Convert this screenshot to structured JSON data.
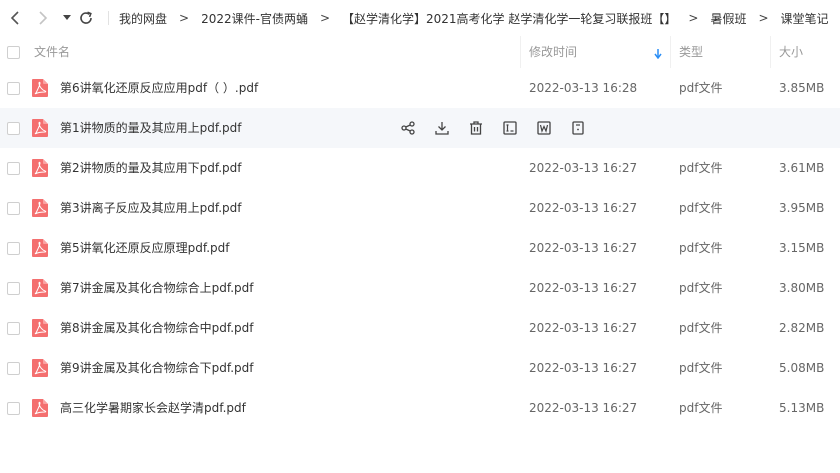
{
  "nav": {
    "back_icon": "chevron-left-icon",
    "forward_icon": "chevron-right-icon",
    "dropdown_icon": "caret-down-icon",
    "refresh_icon": "refresh-icon"
  },
  "breadcrumb": [
    "我的网盘",
    "2022课件-官债两蛹",
    "【赵学清化学】2021高考化学 赵学清化学一轮复习联报班【】",
    "暑假班",
    "课堂笔记"
  ],
  "breadcrumb_separator": ">",
  "columns": {
    "name": "文件名",
    "modified": "修改时间",
    "type": "类型",
    "size": "大小"
  },
  "sort": {
    "column": "modified",
    "direction": "desc",
    "icon": "arrow-down-icon"
  },
  "row_actions": [
    "share-icon",
    "download-icon",
    "delete-icon",
    "rename-icon",
    "word-icon",
    "more-icon"
  ],
  "colors": {
    "pdf": "#f46f6f",
    "sort_arrow": "#2b8ef5",
    "hover_bg": "#f5f7fa"
  },
  "files": [
    {
      "name": "第6讲氧化还原反应应用pdf（ ）.pdf",
      "modified": "2022-03-13 16:28",
      "type": "pdf文件",
      "size": "3.85MB"
    },
    {
      "name": "第1讲物质的量及其应用上pdf.pdf",
      "modified": "",
      "type": "",
      "size": "",
      "hovered": true
    },
    {
      "name": "第2讲物质的量及其应用下pdf.pdf",
      "modified": "2022-03-13 16:27",
      "type": "pdf文件",
      "size": "3.61MB"
    },
    {
      "name": "第3讲离子反应及其应用上pdf.pdf",
      "modified": "2022-03-13 16:27",
      "type": "pdf文件",
      "size": "3.95MB"
    },
    {
      "name": "第5讲氧化还原反应原理pdf.pdf",
      "modified": "2022-03-13 16:27",
      "type": "pdf文件",
      "size": "3.15MB"
    },
    {
      "name": "第7讲金属及其化合物综合上pdf.pdf",
      "modified": "2022-03-13 16:27",
      "type": "pdf文件",
      "size": "3.80MB"
    },
    {
      "name": "第8讲金属及其化合物综合中pdf.pdf",
      "modified": "2022-03-13 16:27",
      "type": "pdf文件",
      "size": "2.82MB"
    },
    {
      "name": "第9讲金属及其化合物综合下pdf.pdf",
      "modified": "2022-03-13 16:27",
      "type": "pdf文件",
      "size": "5.08MB"
    },
    {
      "name": "高三化学暑期家长会赵学清pdf.pdf",
      "modified": "2022-03-13 16:27",
      "type": "pdf文件",
      "size": "5.13MB"
    }
  ]
}
